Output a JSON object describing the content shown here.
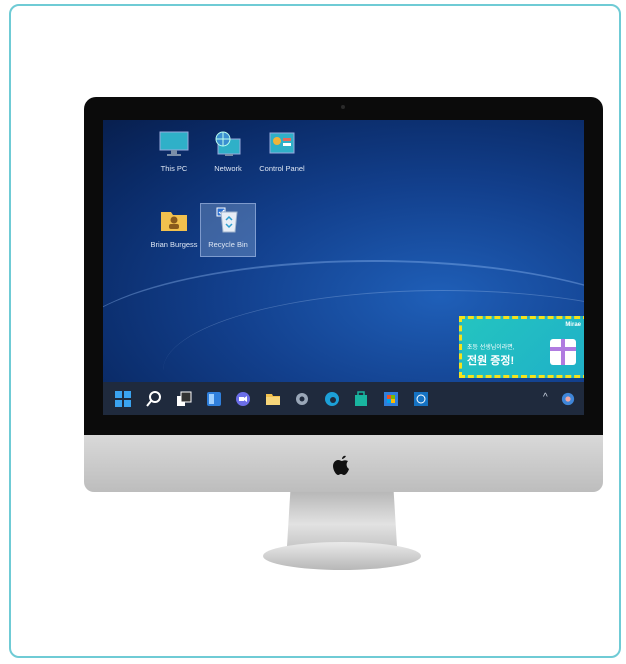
{
  "desktop": {
    "icons": [
      {
        "label": "This PC",
        "icon": "monitor-icon"
      },
      {
        "label": "Network",
        "icon": "network-globe-icon"
      },
      {
        "label": "Control Panel",
        "icon": "control-panel-icon"
      },
      {
        "label": "Brian Burgess",
        "icon": "user-folder-icon"
      },
      {
        "label": "Recycle Bin",
        "icon": "recycle-bin-icon"
      }
    ]
  },
  "ad": {
    "brand": "Mirae",
    "line1": "초등 선생님이라면,",
    "line2": "전원 증정!",
    "highlight_color": "#f4e21c",
    "background_color": "#24c4c0"
  },
  "taskbar": {
    "items": [
      "windows-start-icon",
      "search-icon",
      "task-view-icon",
      "widgets-icon",
      "chat-icon",
      "file-explorer-icon",
      "settings-gear-icon",
      "edge-browser-icon",
      "store-icon",
      "office-icon",
      "dell-icon"
    ],
    "tray": {
      "chevron": "^"
    }
  },
  "colors": {
    "frame_border": "#6fcbd5",
    "taskbar": "#1f2a3d"
  }
}
